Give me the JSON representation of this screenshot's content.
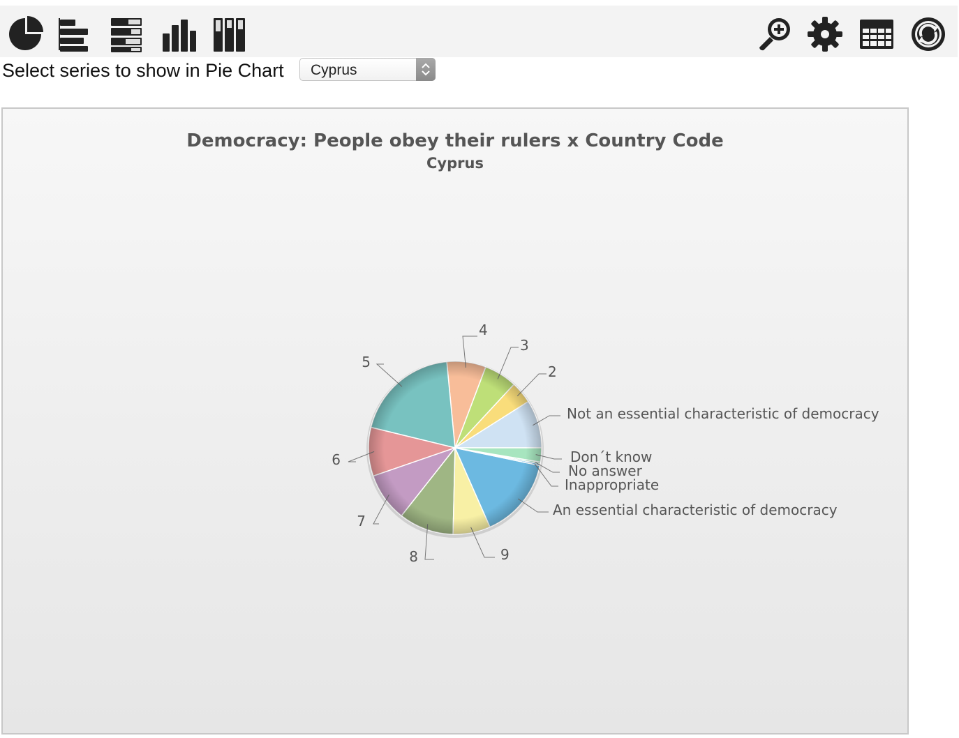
{
  "toolbar": {
    "left_icons": [
      "pie-chart-icon",
      "horizontal-bar-icon",
      "stacked-horizontal-bar-icon",
      "vertical-bar-icon",
      "stacked-vertical-bar-icon"
    ],
    "right_icons": [
      "zoom-icon",
      "settings-gear-icon",
      "table-icon",
      "refresh-icon"
    ],
    "icon_color": "#222222"
  },
  "selector": {
    "label": "Select series to show in Pie Chart",
    "selected": "Cyprus"
  },
  "chart_data": {
    "type": "pie",
    "title": "Democracy: People obey their rulers x Country Code",
    "subtitle": "Cyprus",
    "slices": [
      {
        "label": "Not an essential characteristic of democracy",
        "value": 8.5,
        "color": "#cfe2f3"
      },
      {
        "label": "2",
        "value": 3.9,
        "color": "#f9dd7b"
      },
      {
        "label": "3",
        "value": 5.8,
        "color": "#bedf78"
      },
      {
        "label": "4",
        "value": 6.9,
        "color": "#f8bd99"
      },
      {
        "label": "5",
        "value": 18.6,
        "color": "#78c2c0"
      },
      {
        "label": "6",
        "value": 8.6,
        "color": "#e59697"
      },
      {
        "label": "7",
        "value": 8.6,
        "color": "#c39bc3"
      },
      {
        "label": "8",
        "value": 9.7,
        "color": "#9fb684"
      },
      {
        "label": "9",
        "value": 6.6,
        "color": "#f8f0a5"
      },
      {
        "label": "An essential characteristic of democracy",
        "value": 14.3,
        "color": "#6cb9e1"
      },
      {
        "label": "Inappropriate",
        "value": 0.3,
        "color": "#5dade0"
      },
      {
        "label": "No answer",
        "value": 0.3,
        "color": "#8fd1b0"
      },
      {
        "label": "Don´t know",
        "value": 2.5,
        "color": "#a7e5bf"
      }
    ]
  }
}
